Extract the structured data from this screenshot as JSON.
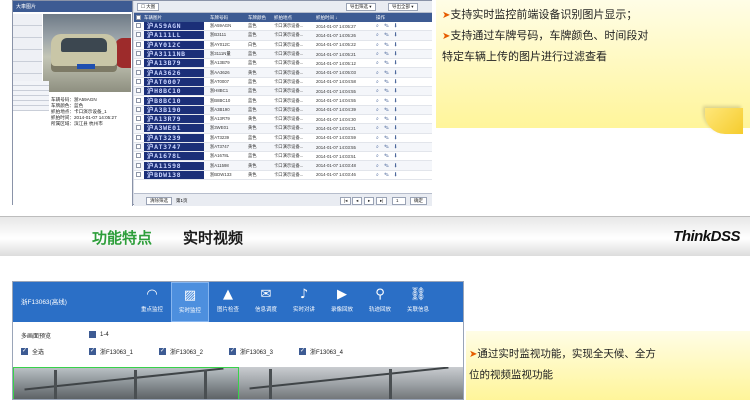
{
  "lpr_panel": {
    "left_header": "大車图片",
    "toolbar_right_1": "导出筛选 ▾",
    "toolbar_right_2": "导出全部 ▾",
    "toolbar_left": "☐ 大图",
    "columns": [
      "",
      "车辆图片",
      "车牌号码",
      "车牌颜色",
      "抓拍地点",
      "抓拍时间 ↓",
      "操作"
    ],
    "rows": [
      {
        "plate_img": "沪A59AGN",
        "plate": "浙A59AGN",
        "color": "蓝色",
        "loc": "卡口演示设备...",
        "time": "2014-01-07 14:05:27"
      },
      {
        "plate_img": "沪A111LL",
        "plate": "浙B3111",
        "color": "蓝色",
        "loc": "卡口演示设备...",
        "time": "2014-01-07 14:05:26"
      },
      {
        "plate_img": "沪AY012C",
        "plate": "浙AY012C",
        "color": "白色",
        "loc": "卡口演示设备...",
        "time": "2014-01-07 14:05:22"
      },
      {
        "plate_img": "沪A3111NB",
        "plate": "浙3111N量",
        "color": "蓝色",
        "loc": "卡口演示设备...",
        "time": "2014-01-07 14:05:21"
      },
      {
        "plate_img": "沪A13B79",
        "plate": "浙A13B79",
        "color": "蓝色",
        "loc": "卡口演示设备...",
        "time": "2014-01-07 14:05:12"
      },
      {
        "plate_img": "沪AA3626",
        "plate": "浙AA3626",
        "color": "黄色",
        "loc": "卡口演示设备...",
        "time": "2014-01-07 14:05:03"
      },
      {
        "plate_img": "沪AT0007",
        "plate": "浙AT0007",
        "color": "蓝色",
        "loc": "卡口演示设备...",
        "time": "2014-01-07 14:04:58"
      },
      {
        "plate_img": "沪H8BC10",
        "plate": "浙H8BC1",
        "color": "蓝色",
        "loc": "卡口演示设备...",
        "time": "2014-01-07 14:04:55"
      },
      {
        "plate_img": "沪B8BC10",
        "plate": "浙B8BC10",
        "color": "蓝色",
        "loc": "卡口演示设备...",
        "time": "2014-01-07 14:04:55"
      },
      {
        "plate_img": "沪A3B190",
        "plate": "浙A3B190",
        "color": "蓝色",
        "loc": "卡口演示设备...",
        "time": "2014-01-07 14:04:39"
      },
      {
        "plate_img": "沪A13R79",
        "plate": "浙A13R79",
        "color": "黄色",
        "loc": "卡口演示设备...",
        "time": "2014-01-07 14:04:30"
      },
      {
        "plate_img": "沪A3WE01",
        "plate": "浙3WE01",
        "color": "黄色",
        "loc": "卡口演示设备...",
        "time": "2014-01-07 14:04:21"
      },
      {
        "plate_img": "沪AT3239",
        "plate": "浙AT3239",
        "color": "蓝色",
        "loc": "卡口演示设备...",
        "time": "2014-01-07 14:03:59"
      },
      {
        "plate_img": "沪AT3747",
        "plate": "浙AT3747",
        "color": "黄色",
        "loc": "卡口演示设备...",
        "time": "2014-01-07 14:03:55"
      },
      {
        "plate_img": "沪A1678L",
        "plate": "浙A1678L",
        "color": "蓝色",
        "loc": "卡口演示设备...",
        "time": "2014-01-07 14:03:51"
      },
      {
        "plate_img": "沪A11598",
        "plate": "浙A11598",
        "color": "黄色",
        "loc": "卡口演示设备...",
        "time": "2014-01-07 14:03:48"
      },
      {
        "plate_img": "沪BDW138",
        "plate": "浙BDW133",
        "color": "黄色",
        "loc": "卡口演示设备...",
        "time": "2014-01-07 14:03:46"
      }
    ],
    "detail_lines": [
      "车辆号码：浙A59AGN",
      "车牌颜色：蓝色",
      "抓拍地点：卡口演示设备_1",
      "抓拍时间：2014-01-07 14:05:27",
      "所属区域：滨江县  杭州市"
    ],
    "footer_left": "清除筛选",
    "footer_mid": "第1页",
    "footer_page_input": "1",
    "footer_go": "确定"
  },
  "note_top": {
    "lines": [
      "支持实时监控前端设备识别图片显示；",
      "支持通过车牌号码，车牌颜色、时间段对",
      "特定车辆上传的图片进行过滤查看"
    ],
    "bullet_lines": [
      true,
      true,
      false
    ]
  },
  "slide_header": {
    "section": "功能特点",
    "title": "实时视频",
    "brand": "ThinkDSS"
  },
  "rtv_panel": {
    "device": "浙F13063(高线)",
    "tabs": [
      {
        "label": "重点监控",
        "icon": "◠"
      },
      {
        "label": "实时监控",
        "icon": "▨"
      },
      {
        "label": "图片检查",
        "icon": "▲"
      },
      {
        "label": "信息调度",
        "icon": "✉"
      },
      {
        "label": "实时对讲",
        "icon": "♪"
      },
      {
        "label": "录像回放",
        "icon": "▶"
      },
      {
        "label": "轨迹回放",
        "icon": "⚲"
      },
      {
        "label": "关联信息",
        "icon": "⛓"
      }
    ],
    "active_tab": "实时监控",
    "multi_view_label": "多画面预览",
    "multi_view_value": "1-4",
    "select_all": "全选",
    "channels": [
      "浙F13063_1",
      "浙F13063_2",
      "浙F13063_3",
      "浙F13063_4"
    ]
  },
  "note_bottom": {
    "lines": [
      "通过实时监视功能，实现全天候、全方",
      "位的视频监视功能"
    ]
  },
  "colors": {
    "accent_green": "#2d9e3a",
    "tab_blue": "#2b6fc6",
    "note_yellow": "#fff59a",
    "bullet_orange": "#e65c00"
  }
}
